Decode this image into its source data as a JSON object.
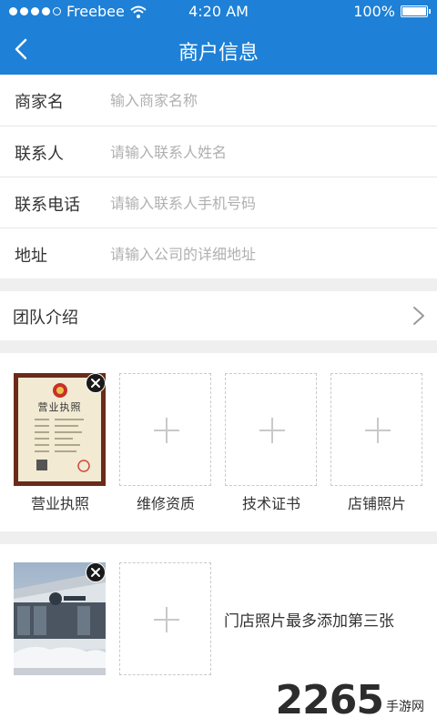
{
  "status_bar": {
    "carrier": "Freebee",
    "time": "4:20 AM",
    "battery": "100%",
    "battery_level": 1.0,
    "signal_bars_filled": 4,
    "signal_bars_total": 5
  },
  "header": {
    "title": "商户信息",
    "back_icon": "chevron-left-icon"
  },
  "form": {
    "merchant_name": {
      "label": "商家名",
      "placeholder": "输入商家名称",
      "value": ""
    },
    "contact_person": {
      "label": "联系人",
      "placeholder": "请输入联系人姓名",
      "value": ""
    },
    "contact_phone": {
      "label": "联系电话",
      "placeholder": "请输入联系人手机号码",
      "value": ""
    },
    "address": {
      "label": "地址",
      "placeholder": "请输入公司的详细地址",
      "value": ""
    }
  },
  "team_intro": {
    "label": "团队介绍",
    "icon": "chevron-right-icon"
  },
  "certificates": [
    {
      "caption": "营业执照",
      "filled": true
    },
    {
      "caption": "维修资质",
      "filled": false
    },
    {
      "caption": "技术证书",
      "filled": false
    },
    {
      "caption": "店铺照片",
      "filled": false
    }
  ],
  "license_image": {
    "heading": "营业执照"
  },
  "store_photos": {
    "hint": "门店照片最多添加第三张"
  },
  "watermark": {
    "number": "2265",
    "suffix": "手游网"
  },
  "colors": {
    "primary": "#1e80d6",
    "background_gap": "#efefef",
    "placeholder": "#b0b0b0",
    "dashed_border": "#c9c9c9"
  }
}
